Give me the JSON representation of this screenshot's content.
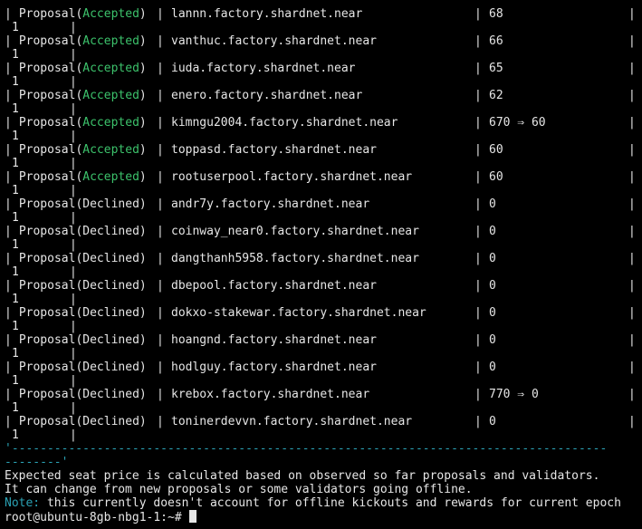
{
  "proposals": [
    {
      "prefix": "Proposal(",
      "status": "Accepted",
      "suffix": ")",
      "account": "lannn.factory.shardnet.near",
      "seats": "68",
      "number": "1"
    },
    {
      "prefix": "Proposal(",
      "status": "Accepted",
      "suffix": ")",
      "account": "vanthuc.factory.shardnet.near",
      "seats": "66",
      "number": "1"
    },
    {
      "prefix": "Proposal(",
      "status": "Accepted",
      "suffix": ")",
      "account": "iuda.factory.shardnet.near",
      "seats": "65",
      "number": "1"
    },
    {
      "prefix": "Proposal(",
      "status": "Accepted",
      "suffix": ")",
      "account": "enero.factory.shardnet.near",
      "seats": "62",
      "number": "1"
    },
    {
      "prefix": "Proposal(",
      "status": "Accepted",
      "suffix": ")",
      "account": "kimngu2004.factory.shardnet.near",
      "seats": "670 ⇒ 60",
      "number": "1"
    },
    {
      "prefix": "Proposal(",
      "status": "Accepted",
      "suffix": ")",
      "account": "toppasd.factory.shardnet.near",
      "seats": "60",
      "number": "1"
    },
    {
      "prefix": "Proposal(",
      "status": "Accepted",
      "suffix": ")",
      "account": "rootuserpool.factory.shardnet.near",
      "seats": "60",
      "number": "1"
    },
    {
      "prefix": "Proposal(",
      "status": "Declined",
      "suffix": ")",
      "account": "andr7y.factory.shardnet.near",
      "seats": "0",
      "number": "1"
    },
    {
      "prefix": "Proposal(",
      "status": "Declined",
      "suffix": ")",
      "account": "coinway_near0.factory.shardnet.near",
      "seats": "0",
      "number": "1"
    },
    {
      "prefix": "Proposal(",
      "status": "Declined",
      "suffix": ")",
      "account": "dangthanh5958.factory.shardnet.near",
      "seats": "0",
      "number": "1"
    },
    {
      "prefix": "Proposal(",
      "status": "Declined",
      "suffix": ")",
      "account": "dbepool.factory.shardnet.near",
      "seats": "0",
      "number": "1"
    },
    {
      "prefix": "Proposal(",
      "status": "Declined",
      "suffix": ")",
      "account": "dokxo-stakewar.factory.shardnet.near",
      "seats": "0",
      "number": "1"
    },
    {
      "prefix": "Proposal(",
      "status": "Declined",
      "suffix": ")",
      "account": "hoangnd.factory.shardnet.near",
      "seats": "0",
      "number": "1"
    },
    {
      "prefix": "Proposal(",
      "status": "Declined",
      "suffix": ")",
      "account": "hodlguy.factory.shardnet.near",
      "seats": "0",
      "number": "1"
    },
    {
      "prefix": "Proposal(",
      "status": "Declined",
      "suffix": ")",
      "account": "krebox.factory.shardnet.near",
      "seats": "770 ⇒ 0",
      "number": "1"
    },
    {
      "prefix": "Proposal(",
      "status": "Declined",
      "suffix": ")",
      "account": "toninerdevvn.factory.shardnet.near",
      "seats": "0",
      "number": "1"
    }
  ],
  "table_separator_line1": "'------------------------------------------------------------------------------------",
  "table_separator_line2": "--------'",
  "messages": {
    "line1": "Expected seat price is calculated based on observed so far proposals and validators.",
    "line2": "It can change from new proposals or some validators going offline.",
    "note_label": "Note:",
    "note_text": " this currently doesn't account for offline kickouts and rewards for current epoch"
  },
  "prompt": {
    "text": "root@ubuntu-8gb-nbg1-1:~# "
  },
  "colors": {
    "background": "#000000",
    "foreground": "#e6e6e6",
    "accepted": "#3cc26b",
    "separator": "#2aa1b3",
    "note": "#2aa1b3"
  }
}
